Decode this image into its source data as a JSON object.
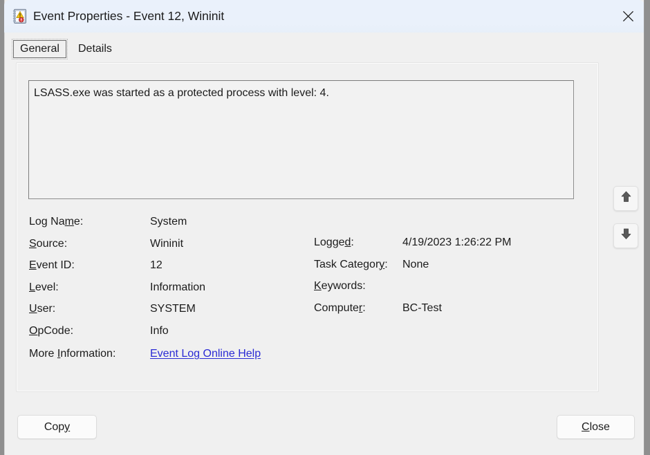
{
  "window": {
    "title": "Event Properties - Event 12, Wininit",
    "icon": "event-log-icon",
    "close_label": "✕"
  },
  "tabs": [
    {
      "label": "General",
      "selected": true
    },
    {
      "label": "Details",
      "selected": false
    }
  ],
  "message": {
    "text": "LSASS.exe was started as a protected process with level: 4."
  },
  "fields_left": [
    {
      "label_pre": "Log Na",
      "label_key": "m",
      "label_post": "e:",
      "value": "System"
    },
    {
      "label_pre": "",
      "label_key": "S",
      "label_post": "ource:",
      "value": "Wininit"
    },
    {
      "label_pre": "",
      "label_key": "E",
      "label_post": "vent ID:",
      "value": "12"
    },
    {
      "label_pre": "",
      "label_key": "L",
      "label_post": "evel:",
      "value": "Information"
    },
    {
      "label_pre": "",
      "label_key": "U",
      "label_post": "ser:",
      "value": "SYSTEM"
    },
    {
      "label_pre": "",
      "label_key": "O",
      "label_post": "pCode:",
      "value": "Info"
    }
  ],
  "fields_right": [
    {
      "label_pre": "Logge",
      "label_key": "d",
      "label_post": ":",
      "value": "4/19/2023 1:26:22 PM"
    },
    {
      "label_pre": "Task Categor",
      "label_key": "y",
      "label_post": ":",
      "value": "None"
    },
    {
      "label_pre": "",
      "label_key": "K",
      "label_post": "eywords:",
      "value": ""
    },
    {
      "label_pre": "Compute",
      "label_key": "r",
      "label_post": ":",
      "value": "BC-Test"
    }
  ],
  "more_information": {
    "label_pre": "More ",
    "label_key": "I",
    "label_post": "nformation:",
    "link_text": "Event Log Online Help",
    "link_color": "#2a2ad4"
  },
  "nav": {
    "up_label": "previous-event",
    "down_label": "next-event"
  },
  "buttons": {
    "copy": {
      "label_pre": "Cop",
      "label_key": "y",
      "label_post": ""
    },
    "close": {
      "label_pre": "",
      "label_key": "C",
      "label_post": "lose"
    }
  },
  "colors": {
    "titlebar": "#eaf1fb",
    "body": "#f0f0f0",
    "link": "#2a2ad4",
    "text": "#1b1b1b"
  }
}
